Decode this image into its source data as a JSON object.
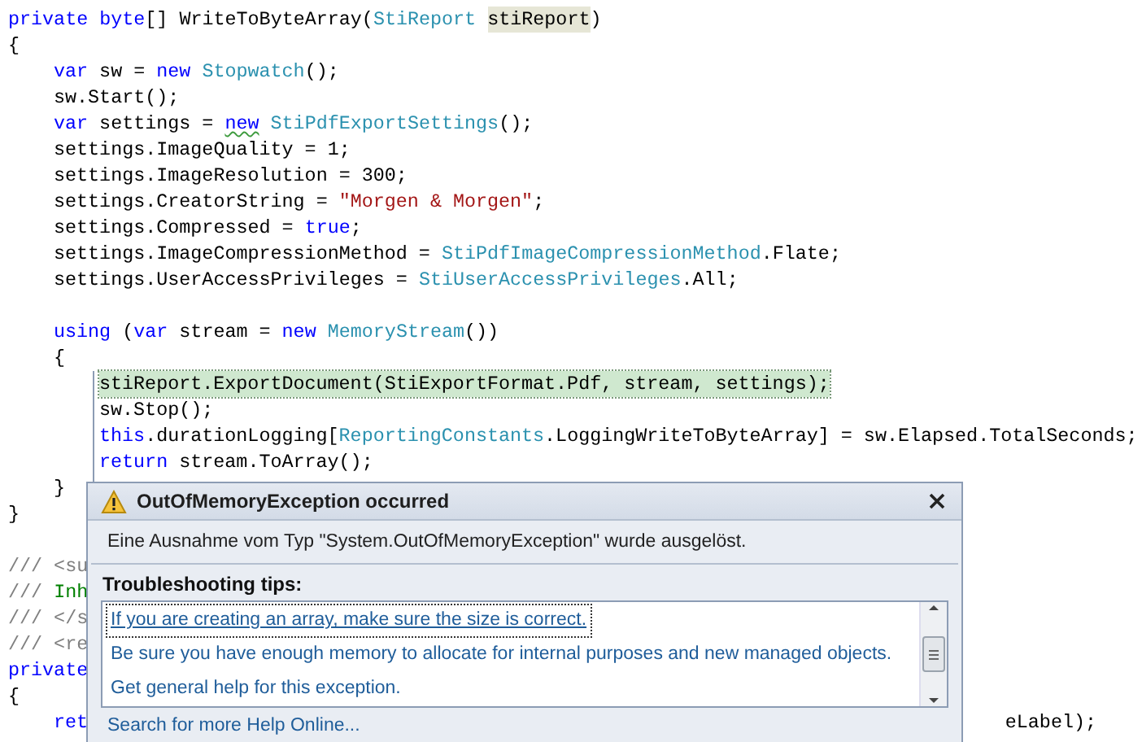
{
  "code_lines": [
    {
      "tokens": [
        {
          "kind": "keyword",
          "text": "private "
        },
        {
          "kind": "keyword",
          "text": "byte"
        },
        {
          "kind": "plain",
          "text": "[] WriteToByteArray("
        },
        {
          "kind": "type",
          "text": "StiReport "
        },
        {
          "kind": "plain",
          "text": "stiReport",
          "highlighted": true
        },
        {
          "kind": "plain",
          "text": ")"
        }
      ]
    },
    {
      "tokens": [
        {
          "kind": "plain",
          "text": "{"
        }
      ],
      "children": [
        {
          "tokens": [
            {
              "kind": "keyword",
              "text": "var"
            },
            {
              "kind": "plain",
              "text": " sw = "
            },
            {
              "kind": "keyword",
              "text": "new "
            },
            {
              "kind": "type",
              "text": "Stopwatch"
            },
            {
              "kind": "plain",
              "text": "();"
            }
          ]
        },
        {
          "tokens": [
            {
              "kind": "plain",
              "text": "sw.Start();"
            }
          ]
        },
        {
          "tokens": [
            {
              "kind": "keyword",
              "text": "var"
            },
            {
              "kind": "plain",
              "text": " settings = "
            },
            {
              "kind": "keyword",
              "text": "new",
              "squiggle": true
            },
            {
              "kind": "type",
              "text": " StiPdfExportSettings"
            },
            {
              "kind": "plain",
              "text": "();"
            }
          ]
        },
        {
          "tokens": [
            {
              "kind": "plain",
              "text": "settings.ImageQuality = 1;"
            }
          ]
        },
        {
          "tokens": [
            {
              "kind": "plain",
              "text": "settings.ImageResolution = 300;"
            }
          ]
        },
        {
          "tokens": [
            {
              "kind": "plain",
              "text": "settings.CreatorString = "
            },
            {
              "kind": "string",
              "text": "\"Morgen & Morgen\""
            },
            {
              "kind": "plain",
              "text": ";"
            }
          ]
        },
        {
          "tokens": [
            {
              "kind": "plain",
              "text": "settings.Compressed = "
            },
            {
              "kind": "keyword",
              "text": "true"
            },
            {
              "kind": "plain",
              "text": ";"
            }
          ]
        },
        {
          "tokens": [
            {
              "kind": "plain",
              "text": "settings.ImageCompressionMethod = "
            },
            {
              "kind": "type",
              "text": "StiPdfImageCompressionMethod"
            },
            {
              "kind": "plain",
              "text": ".Flate;"
            }
          ]
        },
        {
          "tokens": [
            {
              "kind": "plain",
              "text": "settings.UserAccessPrivileges = "
            },
            {
              "kind": "type",
              "text": "StiUserAccessPrivileges"
            },
            {
              "kind": "plain",
              "text": ".All;"
            }
          ]
        },
        {
          "blank_line_before": true,
          "tokens": [
            {
              "kind": "keyword",
              "text": "using"
            },
            {
              "kind": "plain",
              "text": " ("
            },
            {
              "kind": "keyword",
              "text": "var"
            },
            {
              "kind": "plain",
              "text": " stream = "
            },
            {
              "kind": "keyword",
              "text": "new "
            },
            {
              "kind": "type",
              "text": "MemoryStream"
            },
            {
              "kind": "plain",
              "text": "())"
            }
          ]
        },
        {
          "tokens": [
            {
              "kind": "plain",
              "text": "{"
            }
          ],
          "children": [
            {
              "current": true,
              "tokens": [
                {
                  "kind": "plain",
                  "text": "stiReport.ExportDocument(StiExportFormat.Pdf, stream, settings);"
                }
              ]
            },
            {
              "tokens": [
                {
                  "kind": "plain",
                  "text": "sw.Stop();"
                }
              ]
            },
            {
              "tokens": [
                {
                  "kind": "keyword",
                  "text": "this"
                },
                {
                  "kind": "plain",
                  "text": ".durationLogging["
                },
                {
                  "kind": "type",
                  "text": "ReportingConstants"
                },
                {
                  "kind": "plain",
                  "text": ".LoggingWriteToByteArray] = sw.Elapsed.TotalSeconds;"
                }
              ]
            },
            {
              "tokens": [
                {
                  "kind": "keyword",
                  "text": "return"
                },
                {
                  "kind": "plain",
                  "text": " stream.ToArray();"
                }
              ]
            }
          ]
        },
        {
          "tokens": [
            {
              "kind": "plain",
              "text": "}"
            }
          ]
        }
      ]
    },
    {
      "tokens": [
        {
          "kind": "plain",
          "text": "}"
        }
      ]
    },
    {
      "blank_line_before": true,
      "tokens": [
        {
          "kind": "comment",
          "text": "/// <su"
        }
      ]
    },
    {
      "tokens": [
        {
          "kind": "comment",
          "text": "/// "
        },
        {
          "kind": "doc",
          "text": "Inh"
        }
      ]
    },
    {
      "tokens": [
        {
          "kind": "comment",
          "text": "/// </s"
        }
      ]
    },
    {
      "tokens": [
        {
          "kind": "comment",
          "text": "/// <re"
        }
      ]
    },
    {
      "tokens": [
        {
          "kind": "keyword",
          "text": "private"
        }
      ]
    },
    {
      "tokens": [
        {
          "kind": "plain",
          "text": "{"
        }
      ],
      "children": [
        {
          "tokens": [
            {
              "kind": "keyword",
              "text": "ret"
            }
          ],
          "tail": "eLabel);"
        }
      ]
    }
  ],
  "exception_popup": {
    "title": "OutOfMemoryException occurred",
    "message": "Eine Ausnahme vom Typ \"System.OutOfMemoryException\" wurde ausgelöst.",
    "tips_heading": "Troubleshooting tips:",
    "tips": [
      {
        "text": "If you are creating an array, make sure the size is correct.",
        "selected": true
      },
      {
        "text": "Be sure you have enough memory to allocate for internal purposes and new managed objects.",
        "selected": false
      },
      {
        "text": "Get general help for this exception.",
        "selected": false
      }
    ],
    "help_link": "Search for more Help Online..."
  }
}
